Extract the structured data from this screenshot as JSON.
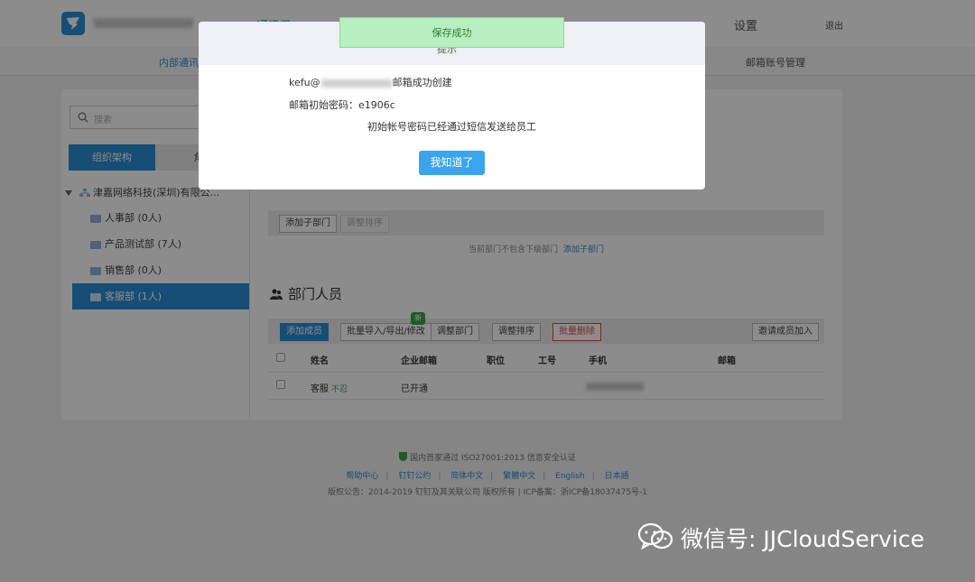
{
  "topbar": {
    "nav": [
      "通讯录",
      "设置"
    ],
    "logout": "退出"
  },
  "subnav": [
    "内部通讯",
    "邮箱账号管理"
  ],
  "sidebar": {
    "search_placeholder": "搜索",
    "tab_org": "组织架构",
    "tab_role": "角",
    "root": "津嘉网络科技(深圳)有限公...",
    "items": [
      {
        "label": "人事部 (0人)"
      },
      {
        "label": "产品测试部 (7人)"
      },
      {
        "label": "销售部 (0人)"
      },
      {
        "label": "客服部 (1人)"
      }
    ]
  },
  "dept": {
    "add_child_btn": "添加子部门",
    "sort_btn": "调整排序",
    "empty_note": "当前部门不包含下级部门",
    "empty_link": "添加子部门"
  },
  "members": {
    "title": "部门人员",
    "new_badge": "新",
    "btns": {
      "add": "添加成员",
      "import": "批量导入/导出/修改",
      "adjust_dept": "调整部门",
      "sort": "调整排序",
      "batch_delete": "批量删除",
      "invite": "邀请成员加入"
    },
    "columns": [
      "姓名",
      "企业邮箱",
      "职位",
      "工号",
      "手机",
      "邮箱"
    ],
    "rows": [
      {
        "name": "客服",
        "tag": "不忍",
        "email_status": "已开通"
      }
    ]
  },
  "footer": {
    "cert": "国内首家通过 ISO27001:2013 信息安全认证",
    "links": [
      "帮助中心",
      "钉钉公约",
      "简体中文",
      "繁體中文",
      "English",
      "日本語"
    ],
    "copyright": "版权公告：2014-2019 钉钉及其关联公司 版权所有 | ICP备案：浙ICP备18037475号-1"
  },
  "dialog": {
    "title": "提示",
    "line1_prefix": "kefu@",
    "line1_suffix": "邮箱成功创建",
    "line2": "邮箱初始密码：e1906c",
    "line3": "初始帐号密码已经通过短信发送给员工",
    "ok": "我知道了"
  },
  "toast": "保存成功",
  "watermark": "微信号: JJCloudService"
}
